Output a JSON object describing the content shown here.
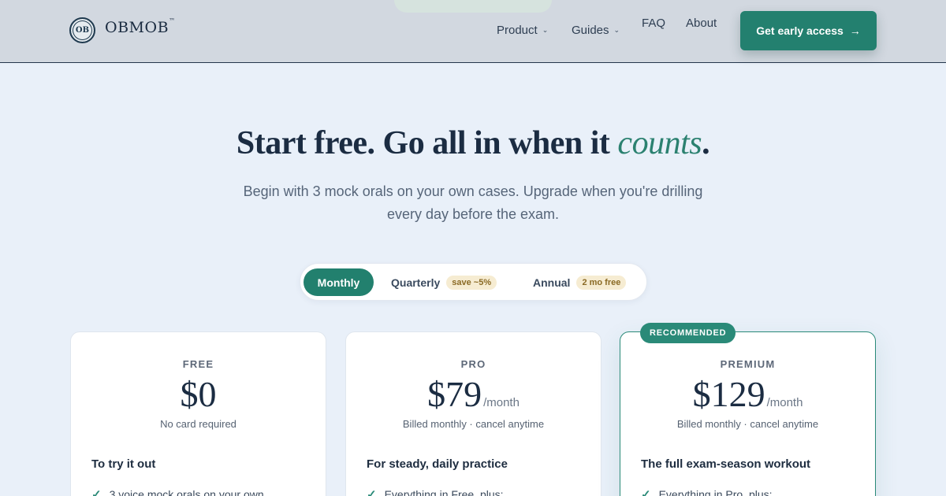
{
  "header": {
    "brand_logo": "OB",
    "brand_name": "OBMOB",
    "brand_tm": "™",
    "nav": [
      {
        "label": "Product",
        "dropdown": true
      },
      {
        "label": "Guides",
        "dropdown": true
      },
      {
        "label": "FAQ",
        "dropdown": false
      },
      {
        "label": "About",
        "dropdown": false
      }
    ],
    "cta_label": "Get early access",
    "cta_arrow": "→"
  },
  "hero": {
    "title_main": "Start free. Go all in when it ",
    "title_accent": "counts",
    "title_end": ".",
    "subtitle": "Begin with 3 mock orals on your own cases. Upgrade when you're drilling every day before the exam."
  },
  "billing": {
    "selected": "Monthly",
    "options": [
      {
        "label": "Monthly",
        "tag": ""
      },
      {
        "label": "Quarterly",
        "tag": "save ~5%"
      },
      {
        "label": "Annual",
        "tag": "2 mo free"
      }
    ]
  },
  "plans": [
    {
      "tier": "FREE",
      "price": "$0",
      "period": "",
      "note": "No card required",
      "heading": "To try it out",
      "first_feature": "3 voice mock orals on your own"
    },
    {
      "tier": "PRO",
      "price": "$79",
      "period": "/month",
      "note": "Billed monthly · cancel anytime",
      "heading": "For steady, daily practice",
      "first_feature": "Everything in Free, plus:"
    },
    {
      "tier": "PREMIUM",
      "badge": "RECOMMENDED",
      "price": "$129",
      "period": "/month",
      "note": "Billed monthly · cancel anytime",
      "heading": "The full exam-season workout",
      "first_feature": "Everything in Pro, plus:"
    }
  ],
  "colors": {
    "accent": "#22806e",
    "background": "#e9f0f9",
    "header": "#d2d8e0",
    "tag_bg": "#f6ecd2",
    "tag_text": "#8a6a25"
  },
  "icons": {
    "chevron": "chevron-down-icon",
    "check": "check-icon",
    "arrow": "arrow-right-icon"
  }
}
